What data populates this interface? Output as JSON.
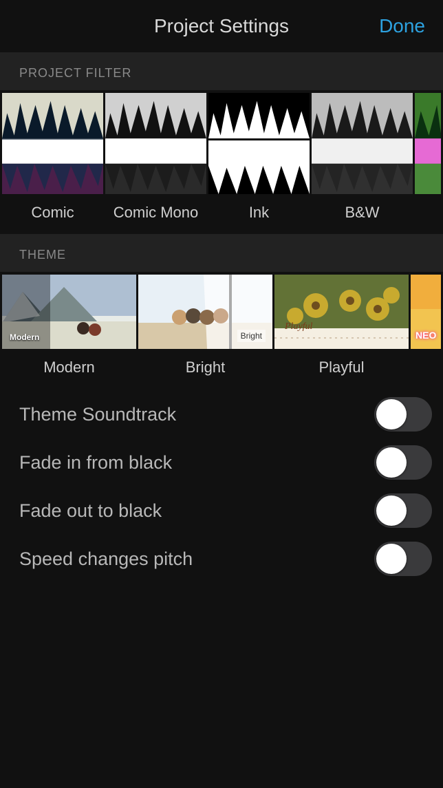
{
  "header": {
    "title": "Project Settings",
    "done_label": "Done"
  },
  "section_filter_label": "PROJECT FILTER",
  "section_theme_label": "THEME",
  "filters": [
    {
      "label": "Comic"
    },
    {
      "label": "Comic Mono"
    },
    {
      "label": "Ink"
    },
    {
      "label": "B&W"
    }
  ],
  "themes": [
    {
      "label": "Modern",
      "overlay": "Modern"
    },
    {
      "label": "Bright",
      "overlay": "Bright"
    },
    {
      "label": "Playful",
      "overlay": "Playful"
    },
    {
      "label_partial": "NEO"
    }
  ],
  "settings": [
    {
      "label": "Theme Soundtrack",
      "on": false
    },
    {
      "label": "Fade in from black",
      "on": false
    },
    {
      "label": "Fade out to black",
      "on": false
    },
    {
      "label": "Speed changes pitch",
      "on": false
    }
  ],
  "colors": {
    "accent": "#2da2e0",
    "switch_off_track": "#3a3a3c"
  }
}
